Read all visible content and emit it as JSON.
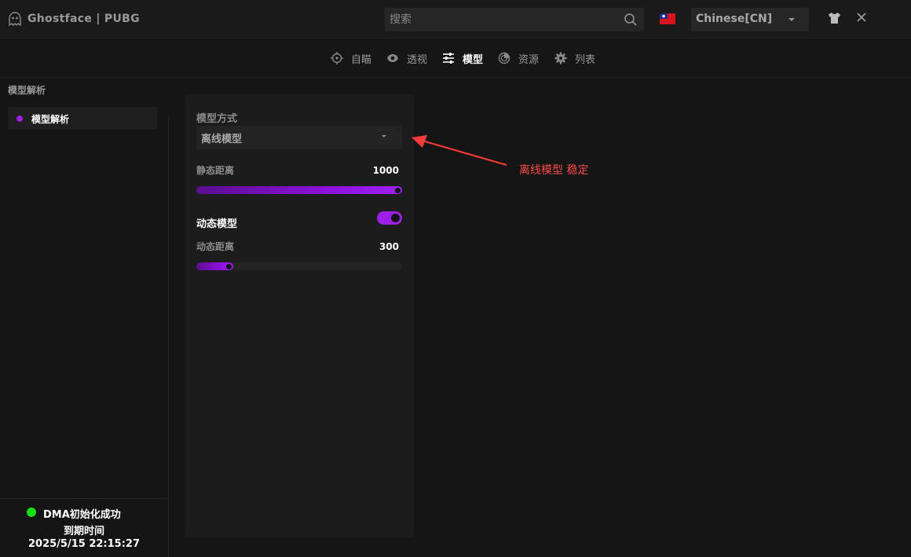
{
  "app": {
    "title": "Ghostface | PUBG"
  },
  "search": {
    "placeholder": "搜索"
  },
  "language": {
    "selected": "Chinese[CN]"
  },
  "nav": {
    "tabs": [
      {
        "label": "自瞄",
        "icon": "crosshair-icon",
        "active": false
      },
      {
        "label": "透视",
        "icon": "eye-icon",
        "active": false
      },
      {
        "label": "模型",
        "icon": "sliders-icon",
        "active": true
      },
      {
        "label": "资源",
        "icon": "radar-icon",
        "active": false
      },
      {
        "label": "列表",
        "icon": "gear-icon",
        "active": false
      }
    ]
  },
  "sidebar": {
    "section_title": "模型解析",
    "items": [
      {
        "label": "模型解析"
      }
    ],
    "status": {
      "text": "DMA初始化成功",
      "expiry_label": "到期时间",
      "expiry_value": "2025/5/15 22:15:27"
    }
  },
  "panel": {
    "mode": {
      "label": "模型方式",
      "value": "离线模型"
    },
    "static_distance": {
      "label": "静态距离",
      "value": "1000",
      "fraction": 1.0
    },
    "dynamic_model": {
      "label": "动态模型",
      "enabled": true
    },
    "dynamic_distance": {
      "label": "动态距离",
      "value": "300",
      "fraction": 0.18
    }
  },
  "annotation": {
    "text": "离线模型 稳定",
    "color": "#ff4a4a"
  },
  "colors": {
    "accent": "#9c1fe8",
    "status_ok": "#10e010",
    "background": "#151515"
  }
}
